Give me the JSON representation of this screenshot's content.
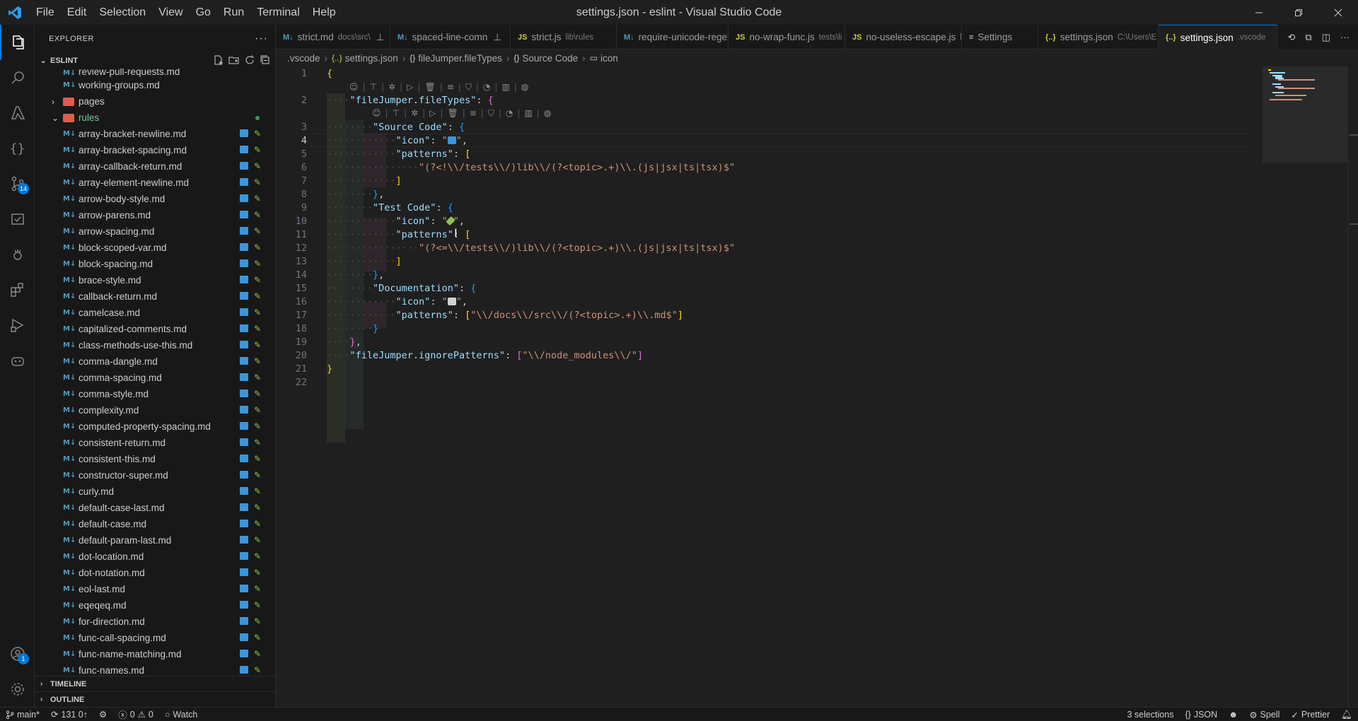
{
  "window": {
    "title": "settings.json - eslint - Visual Studio Code",
    "menu": [
      "File",
      "Edit",
      "Selection",
      "View",
      "Go",
      "Run",
      "Terminal",
      "Help"
    ]
  },
  "activity_bar": {
    "items": [
      "explorer-icon",
      "search-icon",
      "azure-icon",
      "json-icon",
      "source-control-icon",
      "test-icon",
      "run-debug-icon",
      "extensions-icon",
      "remote-icon",
      "copilot-icon"
    ],
    "source_control_badge": "14",
    "accounts_badge": "1"
  },
  "sidebar": {
    "title": "EXPLORER",
    "root": "ESLINT",
    "tree": [
      {
        "label": "review-pull-requests.md",
        "type": "md",
        "indent": 2,
        "partial": true
      },
      {
        "label": "working-groups.md",
        "type": "md",
        "indent": 2
      },
      {
        "label": "pages",
        "type": "folder",
        "indent": 1,
        "expanded": false
      },
      {
        "label": "rules",
        "type": "folder",
        "indent": 1,
        "expanded": true,
        "modified": true
      },
      {
        "label": "array-bracket-newline.md",
        "type": "md",
        "indent": 2
      },
      {
        "label": "array-bracket-spacing.md",
        "type": "md",
        "indent": 2
      },
      {
        "label": "array-callback-return.md",
        "type": "md",
        "indent": 2
      },
      {
        "label": "array-element-newline.md",
        "type": "md",
        "indent": 2
      },
      {
        "label": "arrow-body-style.md",
        "type": "md",
        "indent": 2
      },
      {
        "label": "arrow-parens.md",
        "type": "md",
        "indent": 2
      },
      {
        "label": "arrow-spacing.md",
        "type": "md",
        "indent": 2
      },
      {
        "label": "block-scoped-var.md",
        "type": "md",
        "indent": 2
      },
      {
        "label": "block-spacing.md",
        "type": "md",
        "indent": 2
      },
      {
        "label": "brace-style.md",
        "type": "md",
        "indent": 2
      },
      {
        "label": "callback-return.md",
        "type": "md",
        "indent": 2
      },
      {
        "label": "camelcase.md",
        "type": "md",
        "indent": 2
      },
      {
        "label": "capitalized-comments.md",
        "type": "md",
        "indent": 2
      },
      {
        "label": "class-methods-use-this.md",
        "type": "md",
        "indent": 2
      },
      {
        "label": "comma-dangle.md",
        "type": "md",
        "indent": 2
      },
      {
        "label": "comma-spacing.md",
        "type": "md",
        "indent": 2
      },
      {
        "label": "comma-style.md",
        "type": "md",
        "indent": 2
      },
      {
        "label": "complexity.md",
        "type": "md",
        "indent": 2
      },
      {
        "label": "computed-property-spacing.md",
        "type": "md",
        "indent": 2
      },
      {
        "label": "consistent-return.md",
        "type": "md",
        "indent": 2
      },
      {
        "label": "consistent-this.md",
        "type": "md",
        "indent": 2
      },
      {
        "label": "constructor-super.md",
        "type": "md",
        "indent": 2
      },
      {
        "label": "curly.md",
        "type": "md",
        "indent": 2
      },
      {
        "label": "default-case-last.md",
        "type": "md",
        "indent": 2
      },
      {
        "label": "default-case.md",
        "type": "md",
        "indent": 2
      },
      {
        "label": "default-param-last.md",
        "type": "md",
        "indent": 2
      },
      {
        "label": "dot-location.md",
        "type": "md",
        "indent": 2
      },
      {
        "label": "dot-notation.md",
        "type": "md",
        "indent": 2
      },
      {
        "label": "eol-last.md",
        "type": "md",
        "indent": 2
      },
      {
        "label": "eqeqeq.md",
        "type": "md",
        "indent": 2
      },
      {
        "label": "for-direction.md",
        "type": "md",
        "indent": 2
      },
      {
        "label": "func-call-spacing.md",
        "type": "md",
        "indent": 2
      },
      {
        "label": "func-name-matching.md",
        "type": "md",
        "indent": 2
      },
      {
        "label": "func-names.md",
        "type": "md",
        "indent": 2
      }
    ],
    "bottom_sections": [
      "TIMELINE",
      "OUTLINE"
    ]
  },
  "tabs": [
    {
      "label": "strict.md",
      "desc": "docs\\src\\",
      "kind": "md",
      "pinned": true
    },
    {
      "label": "spaced-line-comn",
      "desc": "",
      "kind": "md",
      "pinned": true
    },
    {
      "label": "strict.js",
      "desc": "lib\\rules",
      "kind": "js"
    },
    {
      "label": "require-unicode-regex",
      "desc": "",
      "kind": "md"
    },
    {
      "label": "no-wrap-func.js",
      "desc": "tests\\li",
      "kind": "js"
    },
    {
      "label": "no-useless-escape.js",
      "desc": "li",
      "kind": "js"
    },
    {
      "label": "Settings",
      "desc": "",
      "kind": "settings"
    },
    {
      "label": "settings.json",
      "desc": "C:\\Users\\E",
      "kind": "json"
    },
    {
      "label": "settings.json",
      "desc": ".vscode",
      "kind": "json",
      "active": true
    }
  ],
  "breadcrumb": [
    ".vscode",
    "settings.json",
    "fileJumper.fileTypes",
    "Source Code",
    "icon"
  ],
  "editor": {
    "current_line": 4,
    "line_numbers": [
      "1",
      "2",
      "3",
      "4",
      "5",
      "6",
      "7",
      "8",
      "9",
      "10",
      "11",
      "12",
      "13",
      "14",
      "15",
      "16",
      "17",
      "18",
      "19",
      "20",
      "21",
      "22"
    ],
    "tokens": {
      "ft_key": "\"fileJumper.fileTypes\"",
      "source_key": "\"Source Code\"",
      "icon_key": "\"icon\"",
      "patterns_key": "\"patterns\"",
      "source_pattern": "\"(?<!\\\\/tests\\\\/)lib\\\\/(?<topic>.+)\\\\.(js|jsx|ts|tsx)$\"",
      "test_key": "\"Test Code\"",
      "test_pattern": "\"(?<=\\\\/tests\\\\/)lib\\\\/(?<topic>.+)\\\\.(js|jsx|ts|tsx)$\"",
      "doc_key": "\"Documentation\"",
      "doc_pattern": "\"\\\\/docs\\\\/src\\\\/(?<topic>.+)\\\\.md$\"",
      "ignore_key": "\"fileJumper.ignorePatterns\"",
      "ignore_pattern": "\"\\\\/node_modules\\\\/\""
    }
  },
  "statusbar": {
    "branch": "main*",
    "sync": "131 0↑",
    "errors": "0",
    "warnings": "0",
    "watch": "Watch",
    "selections": "3 selections",
    "language": "JSON",
    "spell": "Spell",
    "prettier": "Prettier"
  },
  "colors": {
    "accent": "#0078d4",
    "string": "#ce9178",
    "key": "#9cdcfe",
    "bracket1": "#ffd700",
    "bracket2": "#da70d6",
    "bracket3": "#179fff",
    "md_icon": "#519aba",
    "json_icon": "#cbcb41"
  }
}
